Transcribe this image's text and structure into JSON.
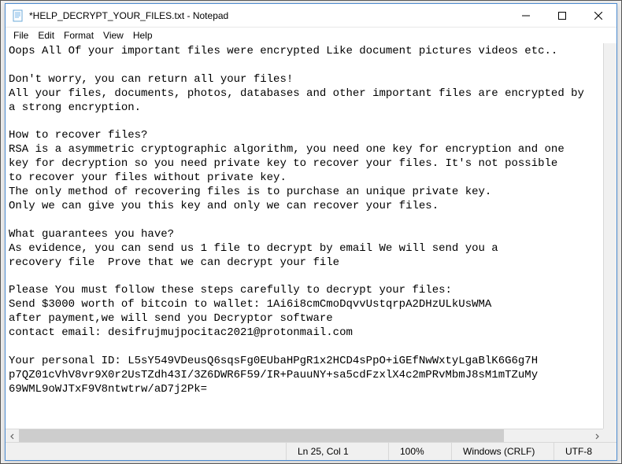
{
  "titlebar": {
    "title": "*HELP_DECRYPT_YOUR_FILES.txt - Notepad"
  },
  "menubar": {
    "file": "File",
    "edit": "Edit",
    "format": "Format",
    "view": "View",
    "help": "Help"
  },
  "content": {
    "body": "Oops All Of your important files were encrypted Like document pictures videos etc..\n\nDon't worry, you can return all your files!\nAll your files, documents, photos, databases and other important files are encrypted by\na strong encryption.\n\nHow to recover files?\nRSA is a asymmetric cryptographic algorithm, you need one key for encryption and one\nkey for decryption so you need private key to recover your files. It's not possible\nto recover your files without private key.\nThe only method of recovering files is to purchase an unique private key.\nOnly we can give you this key and only we can recover your files.\n\nWhat guarantees you have?\nAs evidence, you can send us 1 file to decrypt by email We will send you a\nrecovery file  Prove that we can decrypt your file\n\nPlease You must follow these steps carefully to decrypt your files:\nSend $3000 worth of bitcoin to wallet: 1Ai6i8cmCmoDqvvUstqrpA2DHzULkUsWMA\nafter payment,we will send you Decryptor software\ncontact email: desifrujmujpocitac2021@protonmail.com\n\nYour personal ID: L5sY549VDeusQ6sqsFg0EUbaHPgR1x2HCD4sPpO+iGEfNwWxtyLgaBlK6G6g7H\np7QZ01cVhV8vr9X0r2UsTZdh43I/3Z6DWR6F59/IR+PauuNY+sa5cdFzxlX4c2mPRvMbmJ8sM1mTZuMy\n69WML9oWJTxF9V8ntwtrw/aD7j2Pk="
  },
  "statusbar": {
    "position": "Ln 25, Col 1",
    "zoom": "100%",
    "line_ending": "Windows (CRLF)",
    "encoding": "UTF-8"
  },
  "scrollbar": {
    "left_arrow": "◀",
    "right_arrow": "▶"
  }
}
